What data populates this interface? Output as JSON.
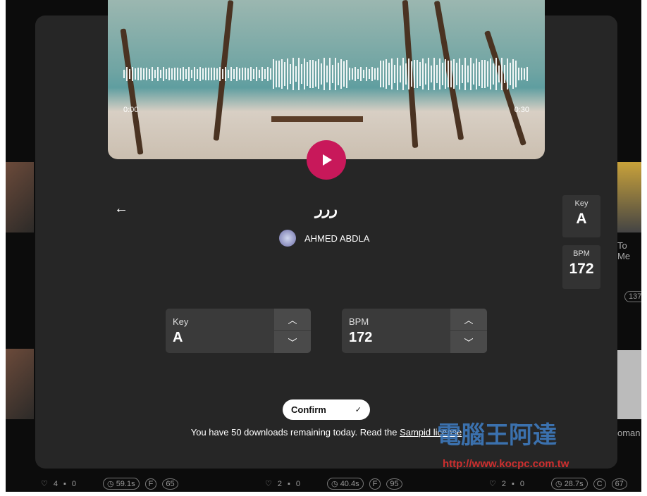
{
  "player": {
    "time_start": "0:00",
    "time_end": "0:30"
  },
  "track": {
    "title": "ررر",
    "artist": "AHMED ABDLA",
    "key_label": "Key",
    "key": "A",
    "bpm_label": "BPM",
    "bpm": "172"
  },
  "key_stepper": {
    "label": "Key",
    "value": "A"
  },
  "bpm_stepper": {
    "label": "BPM",
    "value": "172"
  },
  "confirm_label": "Confirm",
  "note": {
    "text": "You have 50 downloads remaining today. Read the ",
    "link": "Sampid license"
  },
  "background_cards": [
    {
      "likes": "4",
      "comments": "0",
      "duration": "59.1s",
      "badge": "F",
      "count": "65"
    },
    {
      "likes": "2",
      "comments": "0",
      "duration": "40.4s",
      "badge": "F",
      "count": "95"
    },
    {
      "likes": "2",
      "comments": "0",
      "duration": "28.7s",
      "badge": "C",
      "count": "67"
    }
  ],
  "right_partial": {
    "title1": "To Me",
    "title2": "oman",
    "count": "137"
  },
  "watermark": {
    "text": "電腦王阿達",
    "url": "http://www.kocpc.com.tw"
  },
  "colors": {
    "accent": "#c8185a",
    "modal": "#262626"
  }
}
